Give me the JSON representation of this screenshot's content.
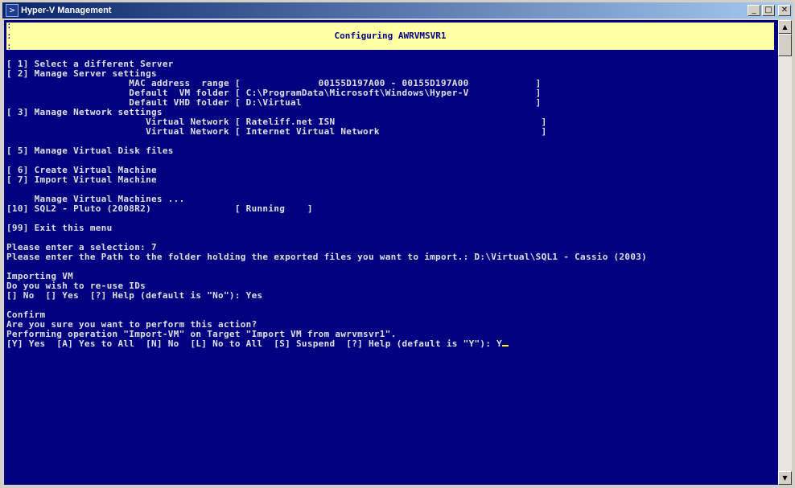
{
  "window": {
    "title": "Hyper-V Management",
    "icon": "powershell-icon",
    "buttons": {
      "minimize": "_",
      "maximize": "□",
      "close": "✕"
    }
  },
  "banner": {
    "border_char": ":",
    "title": "Configuring AWRVMSVR1"
  },
  "console": {
    "lines": [
      "[ 1] Select a different Server",
      "[ 2] Manage Server settings",
      "                      MAC address  range [              00155D197A00 - 00155D197A00            ]",
      "                      Default  VM folder [ C:\\ProgramData\\Microsoft\\Windows\\Hyper-V            ]",
      "                      Default VHD folder [ D:\\Virtual                                          ]",
      "[ 3] Manage Network settings",
      "                         Virtual Network [ Rateliff.net ISN                                     ]",
      "                         Virtual Network [ Internet Virtual Network                             ]",
      "",
      "[ 5] Manage Virtual Disk files",
      "",
      "[ 6] Create Virtual Machine",
      "[ 7] Import Virtual Machine",
      "",
      "     Manage Virtual Machines ...",
      "[10] SQL2 - Pluto (2008R2)               [ Running    ]",
      "",
      "[99] Exit this menu",
      "",
      "Please enter a selection: 7",
      "Please enter the Path to the folder holding the exported files you want to import.: D:\\Virtual\\SQL1 - Cassio (2003)",
      "",
      "Importing VM",
      "Do you wish to re-use IDs",
      "[] No  [] Yes  [?] Help (default is \"No\"): Yes",
      "",
      "Confirm",
      "Are you sure you want to perform this action?",
      "Performing operation \"Import-VM\" on Target \"Import VM from awrvmsvr1\".",
      "[Y] Yes  [A] Yes to All  [N] No  [L] No to All  [S] Suspend  [?] Help (default is \"Y\"): Y"
    ]
  },
  "colors": {
    "console_bg": "#000080",
    "console_text": "#e0e0e0",
    "banner_bg": "#ffffa6",
    "banner_text": "#000080",
    "cursor": "#ffff00"
  },
  "scrollbar": {
    "up_icon": "▲",
    "down_icon": "▼"
  }
}
